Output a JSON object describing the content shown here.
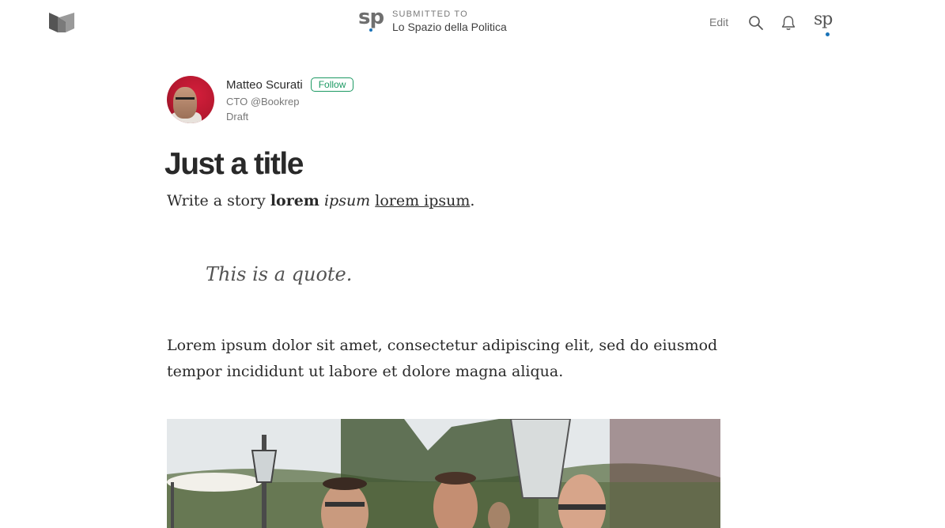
{
  "topbar": {
    "publication": {
      "mark": "sp",
      "submitted_label": "SUBMITTED TO",
      "name": "Lo Spazio della Politica"
    },
    "edit_label": "Edit",
    "icons": {
      "logo": "medium-logo-icon",
      "search": "search-icon",
      "notifications": "bell-icon",
      "user": "user-avatar"
    },
    "user_avatar_mark": "sp"
  },
  "author": {
    "name": "Matteo Scurati",
    "follow_label": "Follow",
    "bio": "CTO @Bookrep",
    "status": "Draft"
  },
  "article": {
    "title": "Just a title",
    "lead": {
      "plain": "Write a story ",
      "bold": "lorem",
      "space1": " ",
      "italic": "ipsum",
      "space2": " ",
      "underlined": "lorem ipsum",
      "end": "."
    },
    "quote": "This is a quote.",
    "paragraph": "Lorem ipsum dolor sit amet, consectetur adipiscing elit, sed do eiusmod tempor incididunt ut labore et dolore magna aliqua."
  },
  "colors": {
    "accent_green": "#1c9963",
    "dot_blue": "#1a73b8",
    "avatar_red": "#c41a35"
  }
}
